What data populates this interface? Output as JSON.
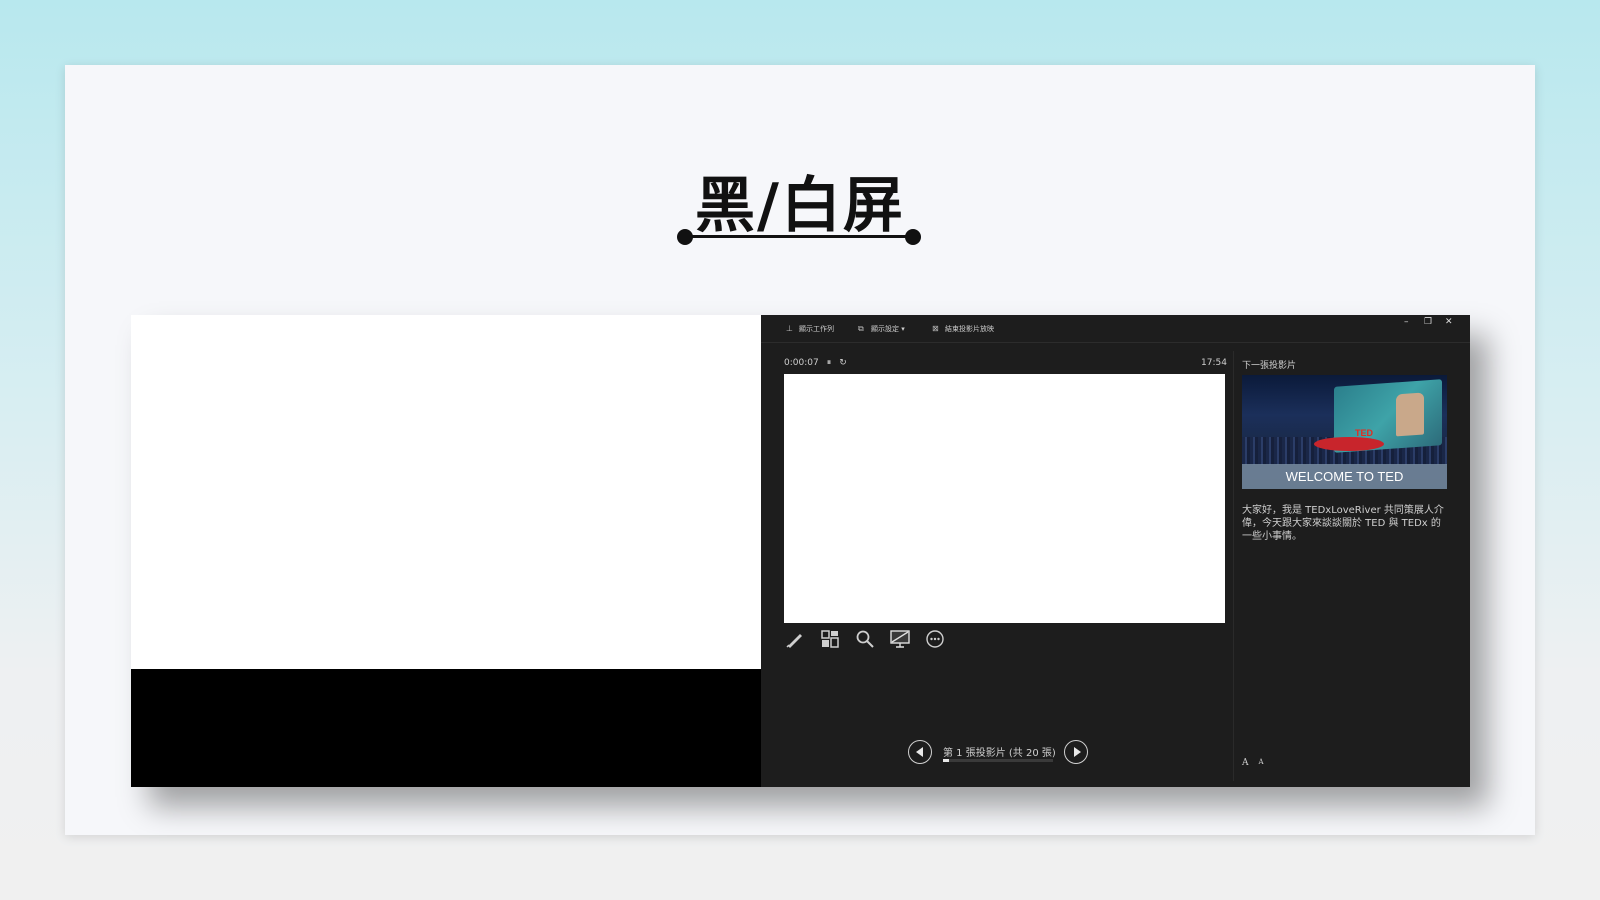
{
  "slide": {
    "title": "黑/白屏"
  },
  "presenter": {
    "toolbar": {
      "taskbar_label": "顯示工作列",
      "display_settings_label": "顯示設定 ▾",
      "end_show_label": "結束投影片放映"
    },
    "window_controls": {
      "minimize": "–",
      "restore": "❐",
      "close": "✕"
    },
    "timer": "0:00:07",
    "clock": "17:54",
    "next_slide_label": "下一張投影片",
    "next_slide_caption": "WELCOME TO TED",
    "next_slide_logo": "TED",
    "notes": "大家好，我是 TEDxLoveRiver 共同策展人介偉，今天跟大家來談談關於 TED 與 TEDx 的一些小事情。",
    "navigation": {
      "slide_counter": "第 1 張投影片 (共 20 張)",
      "progress_fraction": 0.05
    },
    "font_controls": {
      "increase": "A",
      "decrease": "A"
    },
    "tools": [
      "pen-icon",
      "slides-grid-icon",
      "zoom-icon",
      "black-screen-icon",
      "more-options-icon"
    ]
  },
  "colors": {
    "presenter_bg": "#1d1d1d",
    "ted_red": "#e62b1e",
    "title_text": "#111111"
  }
}
